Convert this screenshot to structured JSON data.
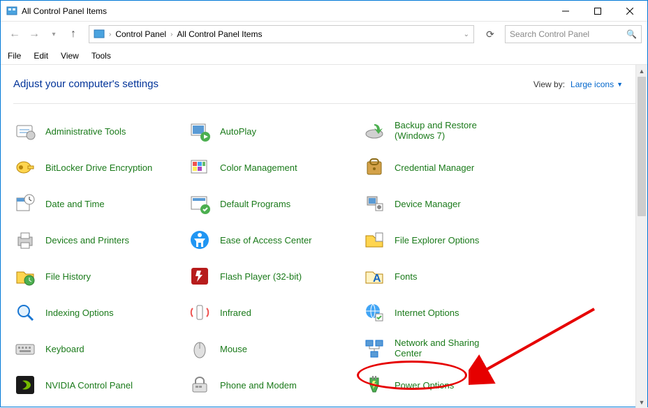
{
  "window": {
    "title": "All Control Panel Items"
  },
  "breadcrumb": {
    "root": "Control Panel",
    "current": "All Control Panel Items"
  },
  "search": {
    "placeholder": "Search Control Panel"
  },
  "menu": {
    "file": "File",
    "edit": "Edit",
    "view": "View",
    "tools": "Tools"
  },
  "header": {
    "heading": "Adjust your computer's settings",
    "viewby_label": "View by:",
    "viewby_value": "Large icons"
  },
  "items": [
    {
      "label": "Administrative Tools",
      "icon": "admin-tools"
    },
    {
      "label": "AutoPlay",
      "icon": "autoplay"
    },
    {
      "label": "Backup and Restore\n(Windows 7)",
      "icon": "backup",
      "two": true
    },
    {
      "label": "BitLocker Drive Encryption",
      "icon": "bitlocker"
    },
    {
      "label": "Color Management",
      "icon": "color"
    },
    {
      "label": "Credential Manager",
      "icon": "credential"
    },
    {
      "label": "Date and Time",
      "icon": "datetime"
    },
    {
      "label": "Default Programs",
      "icon": "defaultprog"
    },
    {
      "label": "Device Manager",
      "icon": "deviceman"
    },
    {
      "label": "Devices and Printers",
      "icon": "devprint"
    },
    {
      "label": "Ease of Access Center",
      "icon": "ease"
    },
    {
      "label": "File Explorer Options",
      "icon": "fileexp"
    },
    {
      "label": "File History",
      "icon": "filehist"
    },
    {
      "label": "Flash Player (32-bit)",
      "icon": "flash"
    },
    {
      "label": "Fonts",
      "icon": "fonts"
    },
    {
      "label": "Indexing Options",
      "icon": "indexing"
    },
    {
      "label": "Infrared",
      "icon": "infrared"
    },
    {
      "label": "Internet Options",
      "icon": "internet"
    },
    {
      "label": "Keyboard",
      "icon": "keyboard"
    },
    {
      "label": "Mouse",
      "icon": "mouse"
    },
    {
      "label": "Network and Sharing\nCenter",
      "icon": "network",
      "two": true
    },
    {
      "label": "NVIDIA Control Panel",
      "icon": "nvidia"
    },
    {
      "label": "Phone and Modem",
      "icon": "phone"
    },
    {
      "label": "Power Options",
      "icon": "power"
    }
  ]
}
